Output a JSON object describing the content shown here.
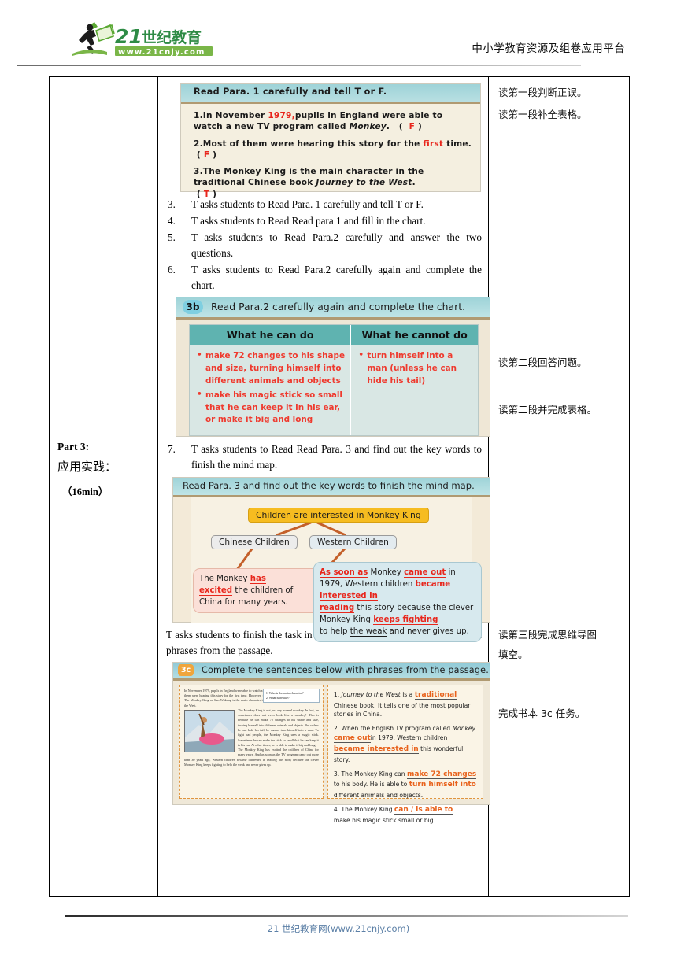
{
  "header": {
    "logo_text_main": "21世纪教育",
    "logo_text_url": "www.21cnjy.com",
    "slogan": "中小学教育资源及组卷应用平台"
  },
  "footer": {
    "text": "21 世纪教育网(www.21cnjy.com)"
  },
  "left_column": {
    "part_label": "Part 3:",
    "part_cn": "应用实践：",
    "duration": "（16min）"
  },
  "right_notes": [
    {
      "text": "读第一段判断正误。"
    },
    {
      "text": "读第一段补全表格。"
    },
    {
      "text": "读第二段回答问题。"
    },
    {
      "text": "读第二段并完成表格。"
    },
    {
      "text": "读第三段完成思维导图"
    },
    {
      "text": "填空。"
    },
    {
      "text": "完成书本 3c 任务。"
    }
  ],
  "steps": [
    {
      "n": "3.",
      "text": "T asks students to Read Para. 1    carefully and tell T or F."
    },
    {
      "n": "4.",
      "text": "T asks students to Read Read para 1 and fill in the chart."
    },
    {
      "n": "5.",
      "text": "T asks students to Read Para.2 carefully and answer the two questions."
    },
    {
      "n": "6.",
      "text": "T asks students to Read Para.2 carefully again and complete the chart."
    },
    {
      "n": "7.",
      "text": "T asks students to Read Read Para. 3 and    find out the key words to finish the mind map."
    }
  ],
  "para_3c_intro": "T asks students to finish the task in 3c-- Complete the sentences below with phrases from the passage.",
  "slide_tf": {
    "title": "Read Para. 1  carefully and tell T or F.",
    "items": [
      {
        "num": "1.",
        "pre": "In November ",
        "red": "1979,",
        "mid": "pupils in England were able to watch a new TV program called ",
        "italic": "Monkey",
        "post": ".",
        "answer": "F"
      },
      {
        "num": "2.",
        "pre": "Most of them were hearing this story for the ",
        "red": "first",
        "mid": " time.",
        "italic": "",
        "post": "",
        "answer": "F"
      },
      {
        "num": "3.",
        "pre": "The Monkey King is the main character in the traditional Chinese book ",
        "red": "",
        "mid": "",
        "italic": "Journey to the West",
        "post": ".",
        "answer": "T"
      }
    ]
  },
  "slide_3b": {
    "badge": "3b",
    "title": "Read Para.2 carefully again and complete the chart.",
    "col1_header": "What he can do",
    "col2_header": "What he cannot do",
    "col1_items": [
      "make 72 changes to his shape and size, turning himself into different animals and objects",
      "make his magic stick so small that he can keep it in his ear, or make it big and long"
    ],
    "col2_items": [
      "turn himself into a man (unless he can hide his tail)"
    ]
  },
  "slide_mindmap": {
    "title": "Read Para. 3 and  find out the key words to finish the mind map.",
    "root": "Children are interested in Monkey King",
    "branch_left": "Chinese Children",
    "branch_right": "Western Children",
    "leaf_left": {
      "p1": "The Monkey ",
      "f1": "has",
      "f2": "excited",
      "p2": " the children of China for many years."
    },
    "leaf_right": {
      "f1": "As soon as",
      "p1": " Monkey ",
      "f2": "came out",
      "p2": " in 1979, Western children ",
      "f3": "became interested in",
      "f4": "reading",
      "p3": " this story because the clever Monkey King ",
      "f5": "keeps fighting",
      "p4": "to help ",
      "f6": "the weak",
      "p5": " and never gives up."
    }
  },
  "slide_3c": {
    "badge": "3c",
    "title": "Complete the sentences below with phrases from the passage.",
    "passage_paragraphs": [
      "In November 1979, pupils in England were able to watch a new TV program called Monkey. Most of them were hearing this story for the first time. However, this story is not new to Chinese children. The Monkey King or Sun Wukong is the main character in the traditional Chinese book Journey to the West.",
      "The Monkey King is not just any normal monkey. In fact, he sometimes does not even look like a monkey! This is because he can make 72 changes to his shape and size, turning himself into different animals and objects. But unless he can hide his tail, he cannot turn himself into a man. To fight bad people, the Monkey King uses a magic stick. Sometimes he can make the stick so small that he can keep it in his ear. At other times, he is able to make it big and long.",
      "The Monkey King has excited the children of China for many years. And as soon as the TV program came out more than 30 years ago, Western children became interested in reading this story because the clever Monkey King keeps fighting to help the weak and never gives up."
    ],
    "passage_questions": [
      "1. Who is the main character?",
      "2. What is he like?"
    ],
    "answers": [
      {
        "n": "1.",
        "a": "Journey to the West",
        "b": " is a ",
        "fill": "traditional",
        "c": " Chinese book. It tells one of the most popular stories in China."
      },
      {
        "n": "2.",
        "a": "When the English TV program called ",
        "b": "Monkey",
        "fill": "came out",
        "c": "in 1979, Western children ",
        "fill2": "became interested in",
        "d": " this wonderful story."
      },
      {
        "n": "3.",
        "a": "The Monkey King can ",
        "fill": "make 72 changes",
        "b": " to his body. He is able to ",
        "fill2": "turn himself into",
        "c": " different animals and objects."
      },
      {
        "n": "4.",
        "a": "The Monkey King ",
        "fill": "can / is able to",
        "b": " make his magic stick small or big."
      }
    ]
  }
}
